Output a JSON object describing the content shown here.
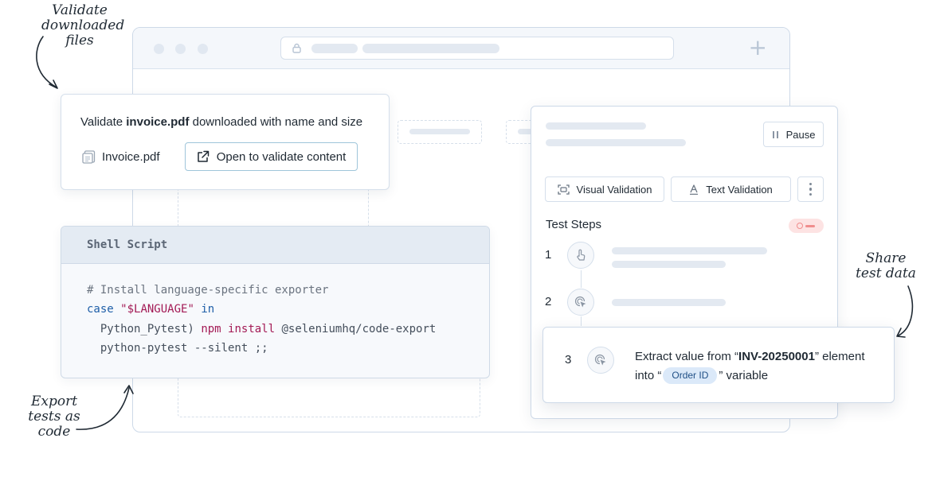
{
  "annotations": {
    "top_left": [
      "Validate",
      "downloaded",
      "files"
    ],
    "bottom_left": [
      "Export",
      "tests as",
      "code"
    ],
    "right": [
      "Share",
      "test data"
    ]
  },
  "validate_card": {
    "title_prefix": "Validate ",
    "title_file": "invoice.pdf",
    "title_suffix": " downloaded with name and size",
    "file_name": "Invoice.pdf",
    "open_button": "Open to validate content",
    "file_icon": "pdf-file-icon",
    "open_icon": "external-link-icon"
  },
  "shell": {
    "title": "Shell Script",
    "line1": "# Install language-specific exporter",
    "line2_kw": "case",
    "line2_str": "\"$LANGUAGE\"",
    "line2_in": "in",
    "line3_case": "Python_Pytest)",
    "line3_cmd": "npm install",
    "line3_arg": "@seleniumhq/code-export",
    "line4": "python-pytest --silent ;;"
  },
  "panel": {
    "pause_label": "Pause",
    "visual_validation": "Visual Validation",
    "text_validation": "Text Validation",
    "steps_title": "Test Steps",
    "step1_num": "1",
    "step2_num": "2",
    "step1_icon": "tap-gesture-icon",
    "step2_icon": "cursor-click-icon"
  },
  "step3": {
    "num": "3",
    "icon": "cursor-click-icon",
    "text_prefix": "Extract value from “",
    "text_value": "INV-20250001",
    "text_mid": "” element",
    "text_into": "into “",
    "variable_chip": "Order ID",
    "text_suffix": "” variable"
  },
  "colors": {
    "border": "#cdd9e8",
    "skeleton": "#e3e9f1",
    "chip_bg": "#dbe9f9",
    "toggle_bg": "#fde3e3",
    "toggle_fg": "#f08d8d",
    "code_keyword": "#1f5fa8",
    "code_string": "#2e8a57",
    "code_variable": "#a31a55"
  }
}
